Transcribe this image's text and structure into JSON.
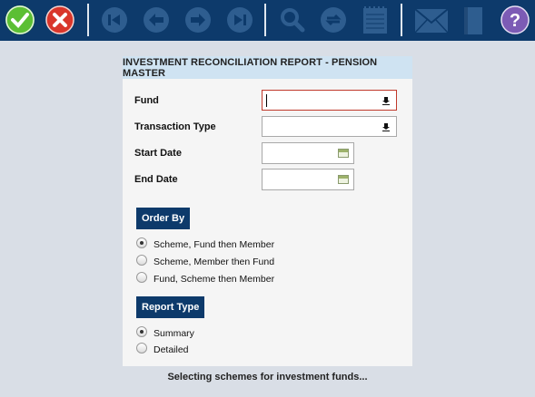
{
  "toolbar": {
    "colors": {
      "bar": "#0d3a6b",
      "ok": "#4caf2a",
      "cancel": "#d9362b",
      "help": "#7c5bb5",
      "disabled": "#2e5d8f"
    },
    "buttons": [
      {
        "icon": "check-icon",
        "enabled": true
      },
      {
        "icon": "close-icon",
        "enabled": true
      },
      {
        "icon": "first-record-icon",
        "enabled": false
      },
      {
        "icon": "previous-record-icon",
        "enabled": false
      },
      {
        "icon": "next-record-icon",
        "enabled": false
      },
      {
        "icon": "last-record-icon",
        "enabled": false
      },
      {
        "icon": "search-icon",
        "enabled": false
      },
      {
        "icon": "refresh-icon",
        "enabled": false
      },
      {
        "icon": "notepad-icon",
        "enabled": false
      },
      {
        "icon": "mail-icon",
        "enabled": false
      },
      {
        "icon": "book-icon",
        "enabled": false
      },
      {
        "icon": "help-icon",
        "enabled": true
      }
    ]
  },
  "form": {
    "title": "INVESTMENT RECONCILIATION REPORT - PENSION MASTER",
    "fund": {
      "label": "Fund",
      "value": ""
    },
    "transaction_type": {
      "label": "Transaction Type",
      "value": ""
    },
    "start_date": {
      "label": "Start Date",
      "value": ""
    },
    "end_date": {
      "label": "End Date",
      "value": ""
    },
    "order_by": {
      "heading": "Order By",
      "options": [
        "Scheme, Fund then Member",
        "Scheme, Member then Fund",
        "Fund, Scheme then Member"
      ],
      "selected": 0
    },
    "report_type": {
      "heading": "Report Type",
      "options": [
        "Summary",
        "Detailed"
      ],
      "selected": 0
    }
  },
  "status": "Selecting schemes for investment funds..."
}
